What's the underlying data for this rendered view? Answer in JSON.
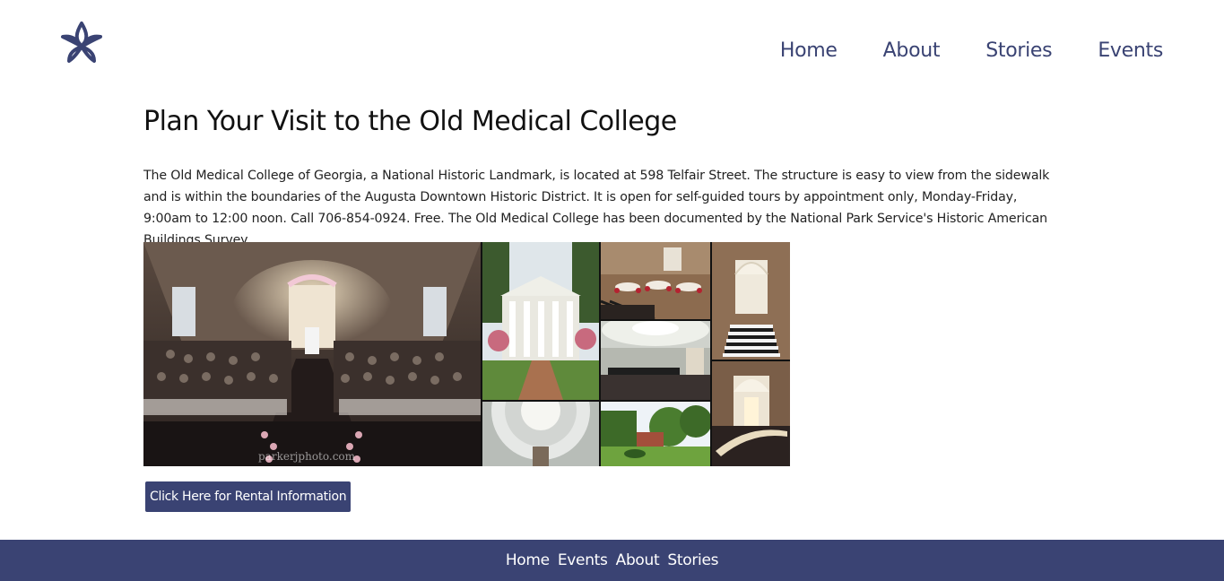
{
  "header": {
    "logo_icon": "star-knot-icon",
    "nav": [
      {
        "label": "Home"
      },
      {
        "label": "About"
      },
      {
        "label": "Stories"
      },
      {
        "label": "Events"
      }
    ]
  },
  "main": {
    "title": "Plan Your Visit to the Old Medical College",
    "description": "The Old Medical College of Georgia, a National Historic Landmark, is located at 598 Telfair Street. The structure is easy to view from the sidewalk and is within the boundaries of the Augusta Downtown Historic District. It is open for self-guided tours by appointment only, Monday-Friday, 9:00am to 12:00 noon. Call 706-854-0924. Free. The Old Medical College has been documented by the National Park Service's Historic American Buildings Survey.",
    "gallery_watermark": "parkerjphoto.com",
    "rental_button": "Click Here for Rental Information"
  },
  "footer": {
    "nav": [
      {
        "label": "Home"
      },
      {
        "label": "Events"
      },
      {
        "label": "About"
      },
      {
        "label": "Stories"
      }
    ]
  },
  "colors": {
    "brand": "#3a4373",
    "background": "#ffffff",
    "text": "#1a1a1a"
  }
}
